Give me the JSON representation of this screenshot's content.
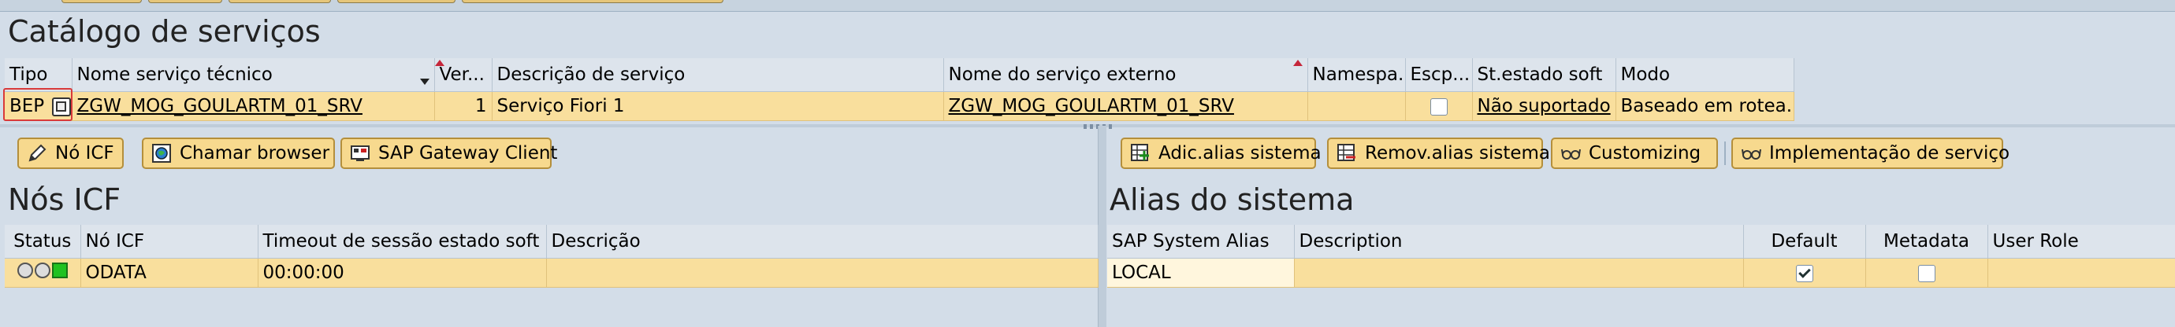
{
  "catalog": {
    "title": "Catálogo de serviços",
    "columns": [
      "Tipo",
      "Nome serviço técnico",
      "Ver...",
      "Descrição de serviço",
      "Nome do serviço externo",
      "Namespa...",
      "Escp...",
      "St.estado soft",
      "Modo"
    ],
    "row": {
      "tipo": "BEP",
      "nome_tecnico": "ZGW_MOG_GOULARTM_01_SRV",
      "versao": "1",
      "descricao": "Serviço Fiori 1",
      "nome_externo": "ZGW_MOG_GOULARTM_01_SRV",
      "namespace": "",
      "escopo_checked": false,
      "st_estado_soft": "Não suportado",
      "modo": "Baseado em rotea..."
    }
  },
  "left_toolbar": {
    "no_icf": "Nó ICF",
    "chamar_browser": "Chamar browser",
    "gateway_client": "SAP Gateway Client"
  },
  "right_toolbar": {
    "adic_alias": "Adic.alias sistema",
    "remov_alias": "Remov.alias sistema",
    "customizing": "Customizing",
    "implementacao": "Implementação de serviço"
  },
  "icf": {
    "title": "Nós ICF",
    "columns": [
      "Status",
      "Nó ICF",
      "Timeout de sessão estado soft",
      "Descrição"
    ],
    "row": {
      "status": "green",
      "no_icf": "ODATA",
      "timeout": "00:00:00",
      "descricao": ""
    }
  },
  "alias": {
    "title": "Alias do sistema",
    "columns": [
      "SAP System Alias",
      "Description",
      "Default",
      "Metadata",
      "User Role"
    ],
    "row": {
      "alias": "LOCAL",
      "description": "",
      "default_checked": true,
      "metadata_checked": false,
      "user_role": ""
    }
  }
}
